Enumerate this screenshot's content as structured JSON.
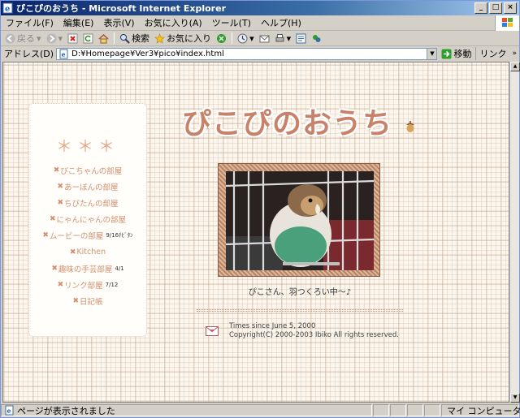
{
  "window": {
    "title": "ぴこぴのおうち - Microsoft Internet Explorer",
    "minimize": "_",
    "maximize": "□",
    "close": "×"
  },
  "menu": [
    "ファイル(F)",
    "編集(E)",
    "表示(V)",
    "お気に入り(A)",
    "ツール(T)",
    "ヘルプ(H)"
  ],
  "toolbar": {
    "back": "戻る",
    "search": "検索",
    "favorites": "お気に入り"
  },
  "address": {
    "label": "アドレス(D)",
    "url": "D:¥Homepage¥Ver3¥pico¥index.html",
    "go": "移動",
    "links": "リンク"
  },
  "page": {
    "logo": "ぴこぴのおうち",
    "stars": "＊＊＊",
    "nav": [
      {
        "label": "ぴこちゃんの部屋",
        "note": ""
      },
      {
        "label": "あーぼんの部屋",
        "note": ""
      },
      {
        "label": "ちびたんの部屋",
        "note": ""
      },
      {
        "label": "にゃんにゃんの部屋",
        "note": ""
      },
      {
        "label": "ムービーの部屋",
        "note": "9/16ﾁﾋﾞﾀﾝ"
      },
      {
        "label": "Kitchen",
        "note": ""
      },
      {
        "label": "趣味の手芸部屋",
        "note": "4/1"
      },
      {
        "label": "リンク部屋",
        "note": "7/12"
      },
      {
        "label": "日記帳",
        "note": ""
      }
    ],
    "caption": "ぴこさん、羽つくろい中〜♪",
    "footer_line1": "Times since June 5, 2000",
    "footer_line2": "Copyright(C) 2000-2003 Ibiko All rights reserved."
  },
  "status": {
    "message": "ページが表示されました",
    "zone": "マイ コンピュータ"
  },
  "colors": {
    "accent": "#c8826a",
    "nav_text": "#d38f6e",
    "title_bar": "#0a246a"
  }
}
